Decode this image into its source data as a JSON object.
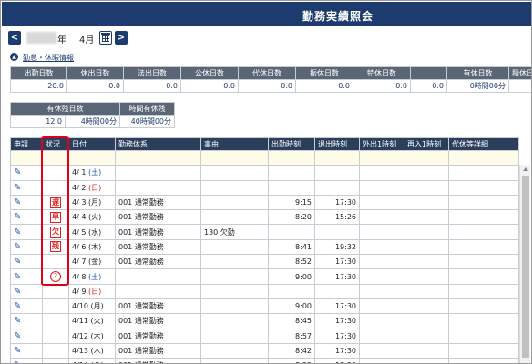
{
  "title": "勤務実績照会",
  "nav": {
    "prev": "<",
    "year_suffix": "年",
    "month": "4月",
    "next": ">"
  },
  "toggle_label": "勤怠・休暇情報",
  "summary_headers": [
    "出勤日数",
    "休出日数",
    "法出日数",
    "公休日数",
    "代休日数",
    "振休日数",
    "特休日数",
    "",
    "有休日数",
    "積休日数"
  ],
  "summary_values": [
    "20.0",
    "0.0",
    "0.0",
    "0.0",
    "0.0",
    "0.0",
    "0.0",
    "0.0",
    "0時間00分",
    ""
  ],
  "remaining_headers": [
    "有休残日数",
    "時間有休残"
  ],
  "remaining_values": [
    "12.0",
    "4時間00分",
    "40時間00分"
  ],
  "attendance_headers": [
    "申請",
    "状況",
    "日付",
    "勤務体系",
    "事由",
    "出勤時刻",
    "退出時刻",
    "外出1時刻",
    "再入1時刻",
    "代休等詳細"
  ],
  "rows": [
    {
      "day": "4/ 1",
      "dow": "(土)",
      "type": "sat",
      "status": "",
      "status_kind": "",
      "shift": "",
      "reason": "",
      "in": "",
      "out": ""
    },
    {
      "day": "4/ 2",
      "dow": "(日)",
      "type": "sun",
      "status": "",
      "status_kind": "",
      "shift": "",
      "reason": "",
      "in": "",
      "out": ""
    },
    {
      "day": "4/ 3",
      "dow": "(月)",
      "type": "",
      "status": "遅",
      "status_kind": "stamp",
      "shift": "001 通常勤務",
      "reason": "",
      "in": "9:15",
      "out": "17:30"
    },
    {
      "day": "4/ 4",
      "dow": "(火)",
      "type": "",
      "status": "早",
      "status_kind": "stamp",
      "shift": "001 通常勤務",
      "reason": "",
      "in": "8:20",
      "out": "15:26"
    },
    {
      "day": "4/ 5",
      "dow": "(水)",
      "type": "",
      "status": "欠",
      "status_kind": "stamp",
      "shift": "001 通常勤務",
      "reason": "130 欠勤",
      "in": "",
      "out": ""
    },
    {
      "day": "4/ 6",
      "dow": "(木)",
      "type": "",
      "status": "残",
      "status_kind": "stamp",
      "shift": "001 通常勤務",
      "reason": "",
      "in": "8:41",
      "out": "19:32"
    },
    {
      "day": "4/ 7",
      "dow": "(金)",
      "type": "",
      "status": "",
      "status_kind": "",
      "shift": "001 通常勤務",
      "reason": "",
      "in": "8:52",
      "out": "17:30"
    },
    {
      "day": "4/ 8",
      "dow": "(土)",
      "type": "sat",
      "status": "?",
      "status_kind": "circle",
      "shift": "",
      "reason": "",
      "in": "9:00",
      "out": "17:30"
    },
    {
      "day": "4/ 9",
      "dow": "(日)",
      "type": "sun",
      "status": "",
      "status_kind": "",
      "shift": "",
      "reason": "",
      "in": "",
      "out": ""
    },
    {
      "day": "4/10",
      "dow": "(月)",
      "type": "",
      "status": "",
      "status_kind": "",
      "shift": "001 通常勤務",
      "reason": "",
      "in": "9:00",
      "out": "17:30"
    },
    {
      "day": "4/11",
      "dow": "(火)",
      "type": "",
      "status": "",
      "status_kind": "",
      "shift": "001 通常勤務",
      "reason": "",
      "in": "8:45",
      "out": "17:30"
    },
    {
      "day": "4/12",
      "dow": "(木)",
      "type": "",
      "status": "",
      "status_kind": "",
      "shift": "001 通常勤務",
      "reason": "",
      "in": "8:57",
      "out": "17:30"
    },
    {
      "day": "4/13",
      "dow": "(木)",
      "type": "",
      "status": "",
      "status_kind": "",
      "shift": "001 通常勤務",
      "reason": "",
      "in": "8:42",
      "out": "17:30"
    },
    {
      "day": "4/14",
      "dow": "(金)",
      "type": "",
      "status": "",
      "status_kind": "",
      "shift": "001 通常勤務",
      "reason": "",
      "in": "8:32",
      "out": "17:30"
    }
  ],
  "colors": {
    "header": "#1d3b6e",
    "highlight": "#e0001b",
    "saturday": "#1d55a8",
    "sunday": "#d22222"
  },
  "icons": {
    "edit": "pencil-icon",
    "calendar": "calendar-icon",
    "collapse": "chevron-up-icon"
  }
}
